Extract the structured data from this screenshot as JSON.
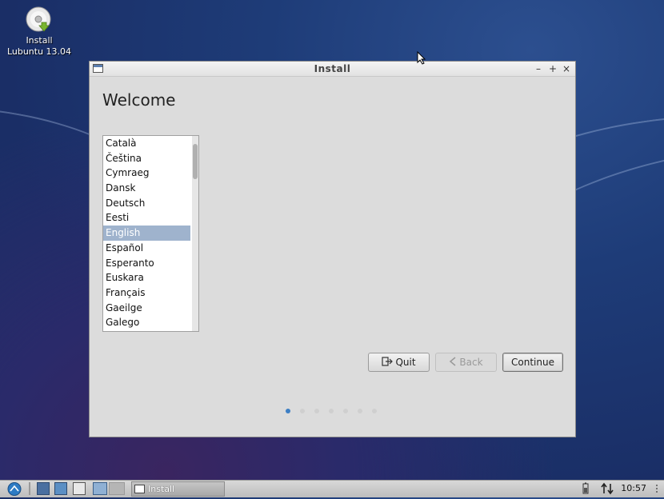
{
  "desktop": {
    "icon_label_line1": "Install",
    "icon_label_line2": "Lubuntu 13.04"
  },
  "window": {
    "title": "Install",
    "controls": {
      "minimize": "–",
      "maximize": "+",
      "close": "×"
    }
  },
  "welcome": {
    "heading": "Welcome"
  },
  "languages": {
    "items": [
      "Català",
      "Čeština",
      "Cymraeg",
      "Dansk",
      "Deutsch",
      "Eesti",
      "English",
      "Español",
      "Esperanto",
      "Euskara",
      "Français",
      "Gaeilge",
      "Galego"
    ],
    "selected": "English"
  },
  "buttons": {
    "quit": "Quit",
    "back": "Back",
    "continue": "Continue"
  },
  "progress": {
    "current_step": 1,
    "total_steps": 7
  },
  "taskbar": {
    "task_label": "Install",
    "clock": "10:57"
  },
  "colors": {
    "selection": "#9fb3cd",
    "active_dot": "#3d7fc4",
    "desktop": "#1c3470"
  }
}
